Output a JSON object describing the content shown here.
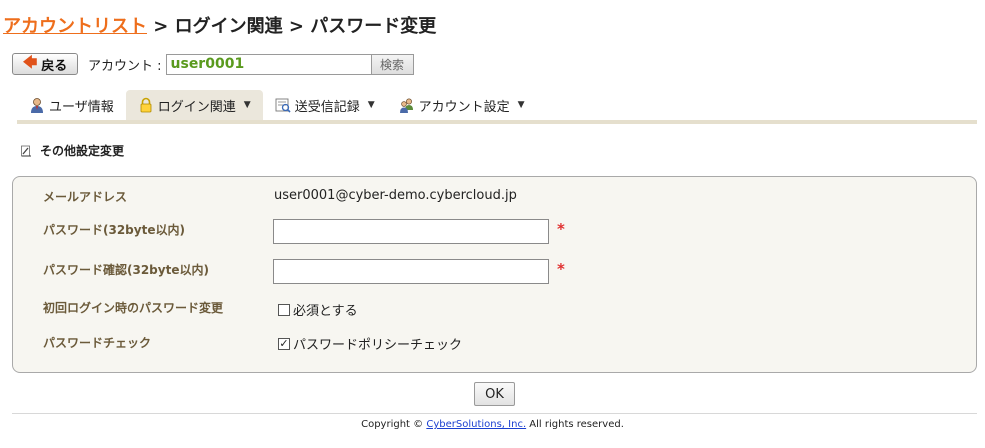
{
  "breadcrumb": {
    "link": "アカウントリスト",
    "rest": " > ログイン関連 > パスワード変更"
  },
  "account_bar": {
    "back_label": "戻る",
    "account_label": "アカウント :",
    "account_value": "user0001",
    "search_label": "検索"
  },
  "tabs": [
    {
      "label": "ユーザ情報",
      "icon": "user-icon"
    },
    {
      "label": "ログイン関連",
      "icon": "lock-icon"
    },
    {
      "label": "送受信記録",
      "icon": "mail-log-icon"
    },
    {
      "label": "アカウント設定",
      "icon": "users-settings-icon"
    }
  ],
  "section": {
    "heading": "その他設定変更"
  },
  "form": {
    "email_label": "メールアドレス",
    "email_value": "user0001@cyber-demo.cybercloud.jp",
    "password_label": "パスワード(32byte以内)",
    "password_confirm_label": "パスワード確認(32byte以内)",
    "required_mark": "*",
    "first_login_label": "初回ログイン時のパスワード変更",
    "first_login_option": "必須とする",
    "first_login_checked": false,
    "policy_label": "パスワードチェック",
    "policy_option": "パスワードポリシーチェック",
    "policy_checked": true
  },
  "ok_label": "OK",
  "footer": {
    "prefix": "Copyright © ",
    "link": "CyberSolutions, Inc.",
    "suffix": " All rights reserved."
  },
  "colors": {
    "breadcrumb_link": "#ee6e1c",
    "account_value": "#5a9a1e",
    "field_label": "#6b5a3a",
    "required": "#e03030",
    "active_tab": "#ebe7dc",
    "footer_link": "#1a3fd0"
  }
}
